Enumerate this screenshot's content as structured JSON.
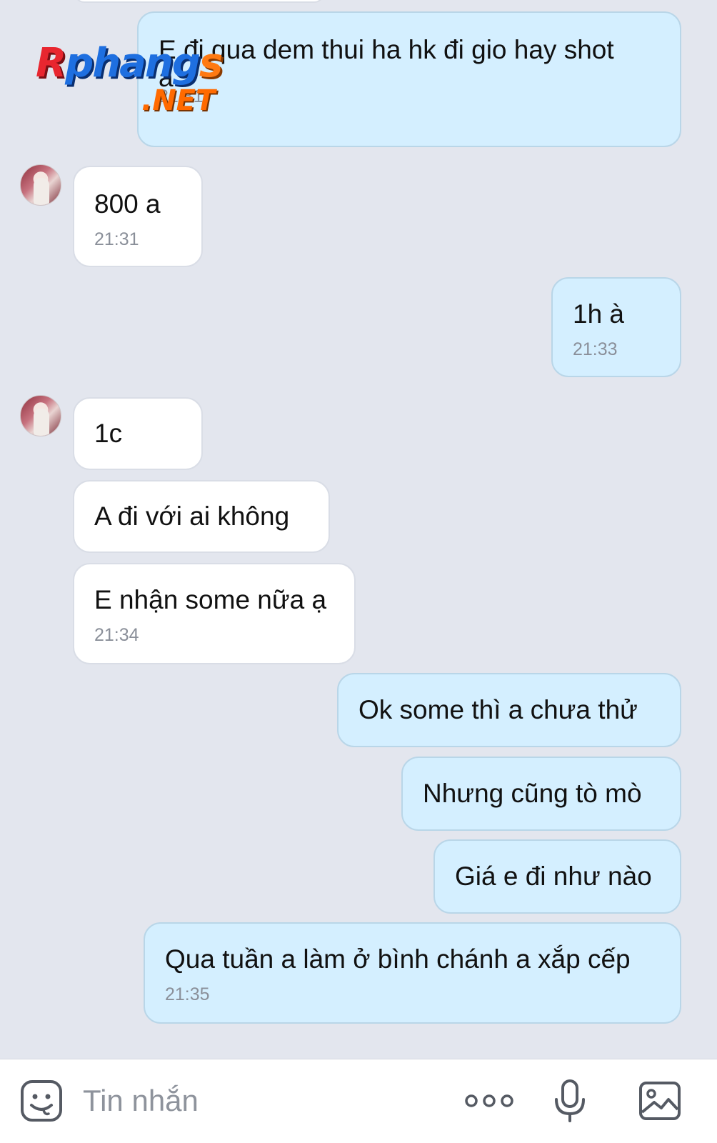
{
  "watermark": {
    "text": "Rphangs",
    "suffix": ".NET"
  },
  "messages": [
    {
      "side": "me",
      "text": "E đi qua dem thui ha hk đi gio hay shot",
      "text_wrap": "a",
      "time": "21:31"
    },
    {
      "side": "them",
      "text": "800 a",
      "time": "21:31"
    },
    {
      "side": "me",
      "text": "1h à",
      "time": "21:33"
    },
    {
      "side": "them",
      "text": "1c",
      "time": ""
    },
    {
      "side": "them",
      "text": "A đi với ai không",
      "time": ""
    },
    {
      "side": "them",
      "text": "E nhận some nữa ạ",
      "time": "21:34"
    },
    {
      "side": "me",
      "text": "Ok some thì a chưa thử",
      "time": ""
    },
    {
      "side": "me",
      "text": "Nhưng cũng tò mò",
      "time": ""
    },
    {
      "side": "me",
      "text": "Giá e đi như nào",
      "time": ""
    },
    {
      "side": "me",
      "text": "Qua tuần a làm ở bình chánh a xắp cếp",
      "time": "21:35"
    }
  ],
  "input": {
    "placeholder": "Tin nhắn"
  },
  "icons": {
    "sticker": "sticker-smile-icon",
    "more": "more-options-icon",
    "mic": "microphone-icon",
    "image": "image-gallery-icon"
  },
  "colors": {
    "background": "#e3e6ee",
    "sent_bubble": "#d4efff",
    "received_bubble": "#ffffff",
    "timestamp": "#8a8f99"
  }
}
